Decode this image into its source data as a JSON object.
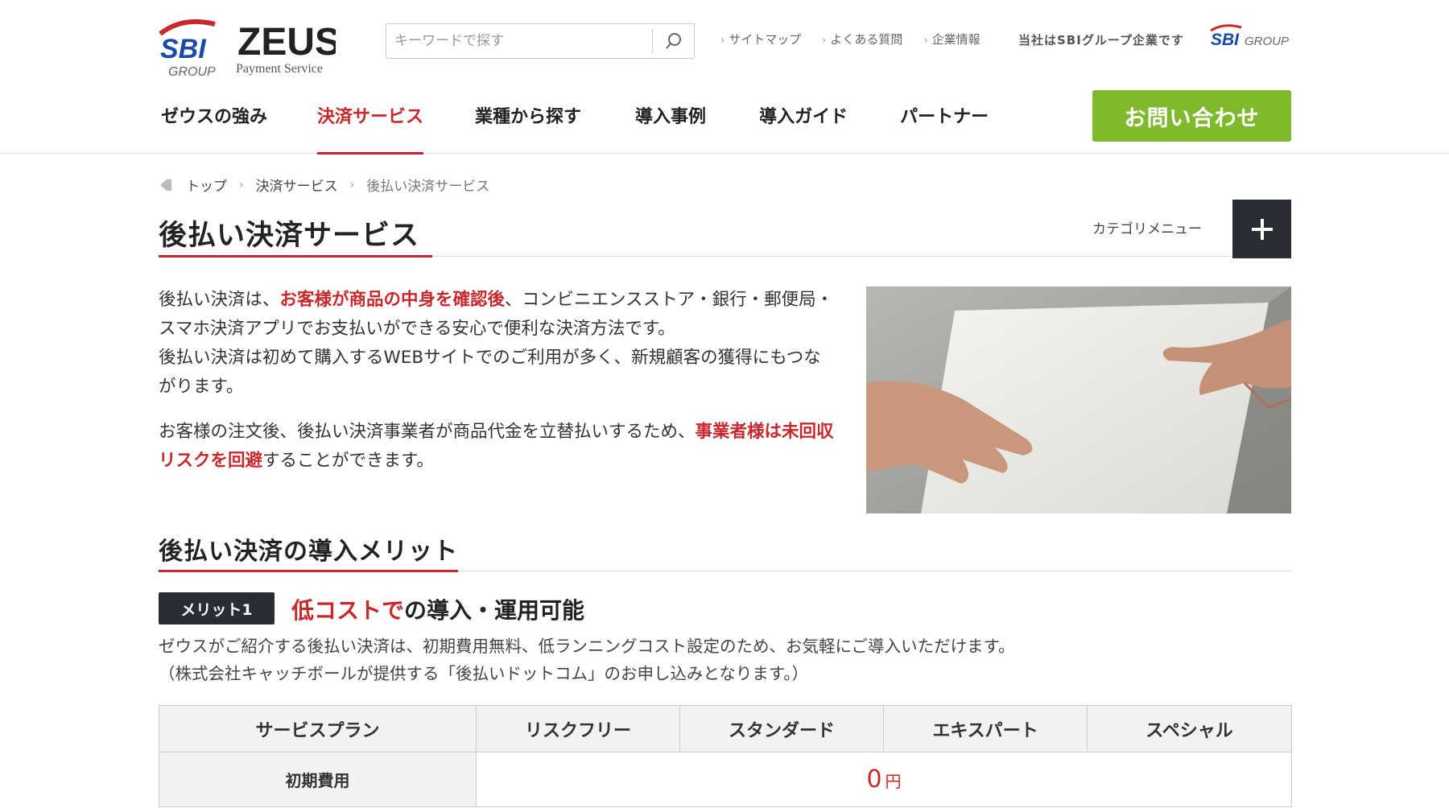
{
  "header": {
    "logo": {
      "sbi": "SBI",
      "group": "GROUP",
      "zeus": "ZEUS",
      "sub": "Payment Service"
    },
    "search": {
      "placeholder": "キーワードで探す"
    },
    "toplinks": [
      "サイトマップ",
      "よくある質問",
      "企業情報"
    ],
    "sbi_text": "当社はSBIグループ企業です",
    "sbi_group_logo": {
      "sbi": "SBI",
      "group": "GROUP"
    },
    "nav": [
      {
        "label": "ゼウスの強み",
        "active": false
      },
      {
        "label": "決済サービス",
        "active": true
      },
      {
        "label": "業種から探す",
        "active": false
      },
      {
        "label": "導入事例",
        "active": false
      },
      {
        "label": "導入ガイド",
        "active": false
      },
      {
        "label": "パートナー",
        "active": false
      }
    ],
    "contact_label": "お問い合わせ"
  },
  "breadcrumb": [
    "トップ",
    "決済サービス",
    "後払い決済サービス"
  ],
  "page_title": "後払い決済サービス",
  "category_menu_label": "カテゴリメニュー",
  "intro": {
    "p1_a": "後払い決済は、",
    "p1_b": "お客様が商品の中身を確認後",
    "p1_c": "、コンビニエンスストア・銀行・郵便局・スマホ決済アプリでお支払いができる安心で便利な決済方法です。",
    "p1_d": "後払い決済は初めて購入するWEBサイトでのご利用が多く、新規顧客の獲得にもつながります。",
    "p2_a": "お客様の注文後、後払い決済事業者が商品代金を立替払いするため、",
    "p2_b": "事業者様は未回収リスクを回避",
    "p2_c": "することができます。"
  },
  "section_title": "後払い決済の導入メリット",
  "merit1": {
    "badge": "メリット1",
    "title_hl": "低コストで",
    "title_rest": "の導入・運用可能",
    "desc1": "ゼウスがご紹介する後払い決済は、初期費用無料、低ランニングコスト設定のため、お気軽にご導入いただけます。",
    "desc2": "（株式会社キャッチボールが提供する「後払いドットコム」のお申し込みとなります。）"
  },
  "plan_table": {
    "headers": [
      "サービスプラン",
      "リスクフリー",
      "スタンダード",
      "エキスパート",
      "スペシャル"
    ],
    "row_label": "初期費用",
    "value": "0",
    "unit": "円"
  },
  "colors": {
    "accent_red": "#c8282b",
    "green": "#7fba2c",
    "dark": "#2a2d34",
    "sbi_blue": "#1a4aa8"
  },
  "icons": [
    "search-icon",
    "home-icon",
    "plus-icon"
  ]
}
